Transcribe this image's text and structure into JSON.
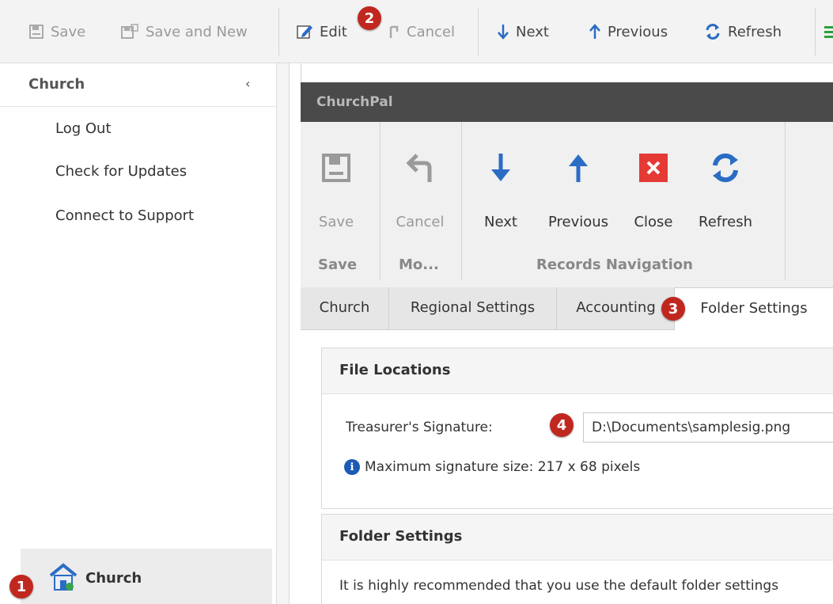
{
  "toolbar": {
    "save": "Save",
    "save_and_new": "Save and New",
    "edit": "Edit",
    "cancel": "Cancel",
    "next": "Next",
    "previous": "Previous",
    "refresh": "Refresh"
  },
  "leftnav": {
    "group_title": "Church",
    "items": [
      "Log Out",
      "Check for Updates",
      "Connect to Support"
    ],
    "footer_label": "Church"
  },
  "window": {
    "title": "ChurchPal"
  },
  "ribbon": {
    "buttons": [
      {
        "label": "Save",
        "icon": "save-icon"
      },
      {
        "label": "Cancel",
        "icon": "undo-icon"
      },
      {
        "label": "Next",
        "icon": "arrow-down-icon"
      },
      {
        "label": "Previous",
        "icon": "arrow-up-icon"
      },
      {
        "label": "Close",
        "icon": "close-icon"
      },
      {
        "label": "Refresh",
        "icon": "refresh-icon"
      }
    ],
    "groups": [
      "Save",
      "Mo...",
      "Records Navigation"
    ]
  },
  "tabs": [
    "Church",
    "Regional Settings",
    "Accounting",
    "Folder Settings"
  ],
  "file_locations": {
    "header": "File Locations",
    "signature_label": "Treasurer's Signature:",
    "signature_value": "D:\\Documents\\samplesig.png",
    "hint": "Maximum signature size: 217 x 68 pixels"
  },
  "folder_settings": {
    "header": "Folder Settings",
    "text": "It is highly recommended that you use the default folder settings"
  },
  "callouts": [
    "1",
    "2",
    "3",
    "4"
  ],
  "colors": {
    "accent_blue": "#2b6cc4",
    "close_red": "#e53935",
    "callout_red": "#c0281f",
    "titlebar": "#4a4a4a"
  }
}
